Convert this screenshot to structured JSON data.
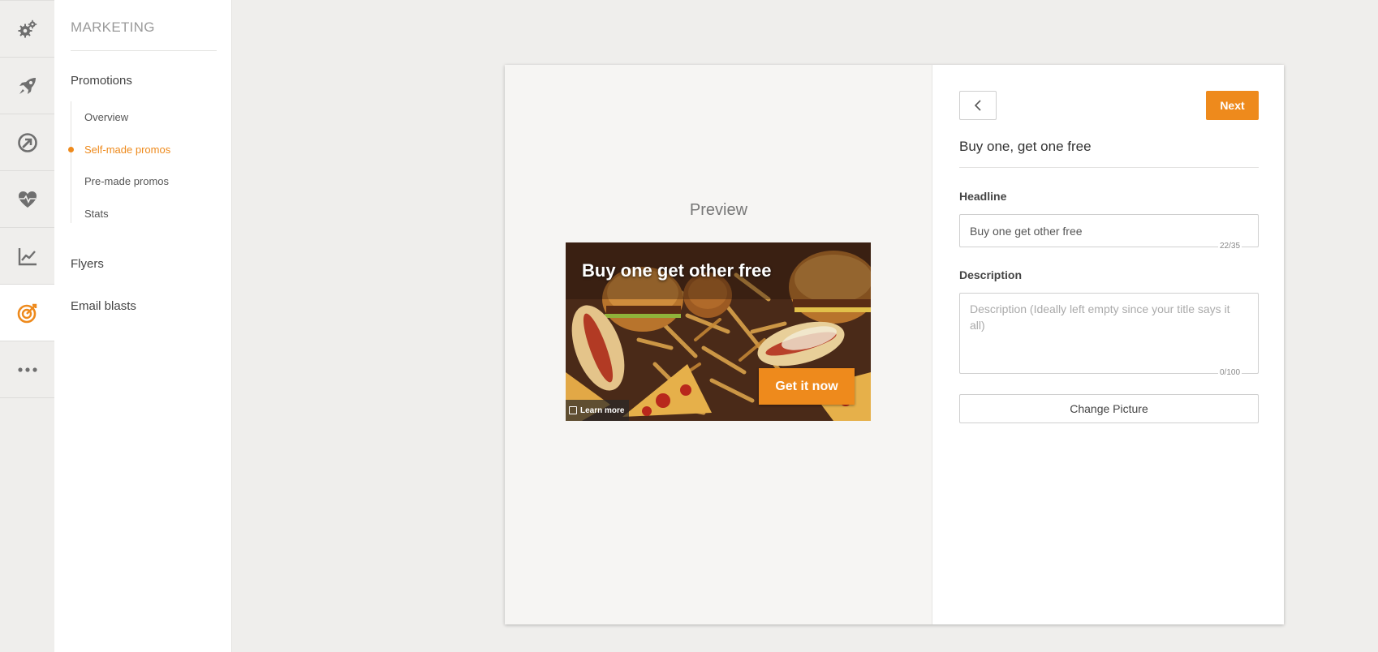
{
  "rail": {
    "items": [
      {
        "icon": "gears-icon",
        "active": false
      },
      {
        "icon": "rocket-icon",
        "active": false
      },
      {
        "icon": "circle-arrow-icon",
        "active": false
      },
      {
        "icon": "heart-pulse-icon",
        "active": false
      },
      {
        "icon": "line-chart-icon",
        "active": false
      },
      {
        "icon": "target-icon",
        "active": true
      },
      {
        "icon": "more-dots-icon",
        "active": false
      }
    ],
    "accent": "#ee8a1c"
  },
  "sidebar": {
    "title": "MARKETING",
    "promotions_label": "Promotions",
    "sub_items": [
      {
        "label": "Overview",
        "active": false
      },
      {
        "label": "Self-made promos",
        "active": true
      },
      {
        "label": "Pre-made promos",
        "active": false
      },
      {
        "label": "Stats",
        "active": false
      }
    ],
    "flyers_label": "Flyers",
    "email_blasts_label": "Email blasts"
  },
  "preview": {
    "label": "Preview",
    "headline": "Buy one get other free",
    "cta_label": "Get it now",
    "learn_more_label": "Learn more"
  },
  "form": {
    "back_icon": "chevron-left-icon",
    "next_label": "Next",
    "title": "Buy one, get one free",
    "headline_label": "Headline",
    "headline_value": "Buy one get other free",
    "headline_counter": "22/35",
    "description_label": "Description",
    "description_value": "",
    "description_placeholder": "Description (Ideally left empty since your title says it all)",
    "description_counter": "0/100",
    "change_picture_label": "Change Picture"
  }
}
